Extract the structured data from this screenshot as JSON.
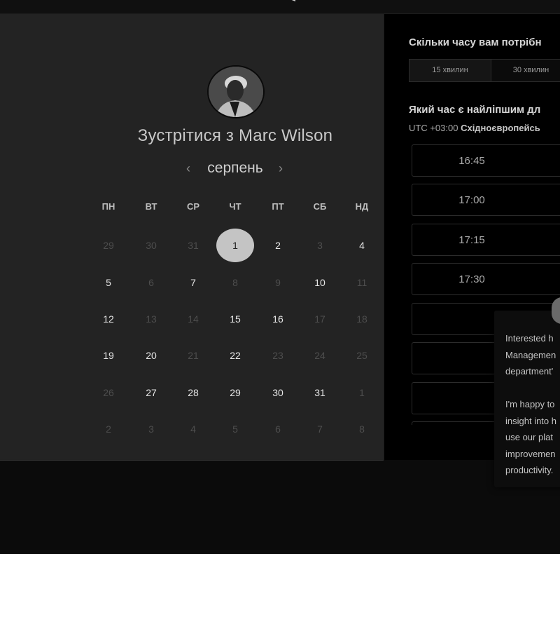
{
  "host": {
    "title": "Зустрітися з Marc Wilson"
  },
  "calendar": {
    "month": "серпень",
    "weekdays": [
      "ПН",
      "ВТ",
      "СР",
      "ЧТ",
      "ПТ",
      "СБ",
      "НД"
    ],
    "weeks": [
      [
        {
          "d": "29",
          "s": "muted"
        },
        {
          "d": "30",
          "s": "muted"
        },
        {
          "d": "31",
          "s": "muted"
        },
        {
          "d": "1",
          "s": "selected"
        },
        {
          "d": "2",
          "s": "available"
        },
        {
          "d": "3",
          "s": "muted"
        },
        {
          "d": "4",
          "s": "available"
        }
      ],
      [
        {
          "d": "5",
          "s": "available"
        },
        {
          "d": "6",
          "s": "muted"
        },
        {
          "d": "7",
          "s": "available"
        },
        {
          "d": "8",
          "s": "muted"
        },
        {
          "d": "9",
          "s": "muted"
        },
        {
          "d": "10",
          "s": "available"
        },
        {
          "d": "11",
          "s": "muted"
        }
      ],
      [
        {
          "d": "12",
          "s": "available"
        },
        {
          "d": "13",
          "s": "muted"
        },
        {
          "d": "14",
          "s": "muted"
        },
        {
          "d": "15",
          "s": "available"
        },
        {
          "d": "16",
          "s": "available"
        },
        {
          "d": "17",
          "s": "muted"
        },
        {
          "d": "18",
          "s": "muted"
        }
      ],
      [
        {
          "d": "19",
          "s": "available"
        },
        {
          "d": "20",
          "s": "available"
        },
        {
          "d": "21",
          "s": "muted"
        },
        {
          "d": "22",
          "s": "available"
        },
        {
          "d": "23",
          "s": "muted"
        },
        {
          "d": "24",
          "s": "muted"
        },
        {
          "d": "25",
          "s": "muted"
        }
      ],
      [
        {
          "d": "26",
          "s": "muted"
        },
        {
          "d": "27",
          "s": "available"
        },
        {
          "d": "28",
          "s": "available"
        },
        {
          "d": "29",
          "s": "available"
        },
        {
          "d": "30",
          "s": "available"
        },
        {
          "d": "31",
          "s": "available"
        },
        {
          "d": "1",
          "s": "muted"
        }
      ],
      [
        {
          "d": "2",
          "s": "muted"
        },
        {
          "d": "3",
          "s": "muted"
        },
        {
          "d": "4",
          "s": "muted"
        },
        {
          "d": "5",
          "s": "muted"
        },
        {
          "d": "6",
          "s": "muted"
        },
        {
          "d": "7",
          "s": "muted"
        },
        {
          "d": "8",
          "s": "muted"
        }
      ]
    ]
  },
  "duration": {
    "question": "Скільки часу вам потрібн",
    "options": [
      "15 хвилин",
      "30 хвилин"
    ]
  },
  "time": {
    "question": "Який час є найліпшим дл",
    "timezone_offset": "UTC +03:00",
    "timezone_name": "Східноєвропейсь",
    "slots": [
      "16:45",
      "17:00",
      "17:15",
      "17:30",
      "",
      "",
      "",
      ""
    ]
  },
  "tooltip": {
    "text": "Interested h\nManagemen\ndepartment'\n\nI'm happy to\ninsight into h\nuse our plat\nimprovemen\nproductivity."
  },
  "colors": {
    "selected_day": "#c4c4c4",
    "panel_left": "#232323",
    "panel_right": "#000000"
  }
}
